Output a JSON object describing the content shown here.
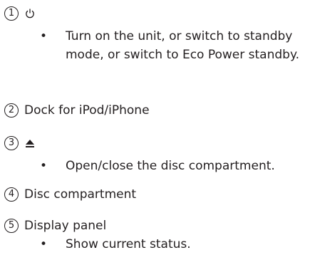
{
  "items": [
    {
      "number": "1",
      "icon": "power-icon",
      "bullets": [
        "Turn on the unit, or switch to standby mode, or switch to Eco Power standby."
      ]
    },
    {
      "number": "2",
      "title": "Dock for iPod/iPhone"
    },
    {
      "number": "3",
      "icon": "eject-icon",
      "bullets": [
        "Open/close the disc compartment."
      ]
    },
    {
      "number": "4",
      "title": "Disc compartment"
    },
    {
      "number": "5",
      "title": "Display panel",
      "bullets": [
        "Show current status."
      ]
    }
  ]
}
